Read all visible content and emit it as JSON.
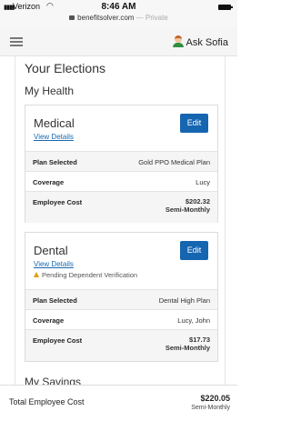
{
  "status_bar": {
    "carrier": "Verizon",
    "time": "8:46 AM",
    "url": "benefitsolver.com",
    "mode": "Private"
  },
  "header": {
    "ask_label": "Ask Sofia"
  },
  "page_title": "Your Elections",
  "sections": {
    "health": "My Health",
    "savings": "My Savings"
  },
  "medical": {
    "title": "Medical",
    "view_details": "View Details",
    "edit_label": "Edit",
    "rows": {
      "plan_label": "Plan Selected",
      "plan_value": "Gold PPO Medical Plan",
      "coverage_label": "Coverage",
      "coverage_value": "Lucy",
      "cost_label": "Employee Cost",
      "cost_value": "$202.32",
      "cost_period": "Semi-Monthly"
    }
  },
  "dental": {
    "title": "Dental",
    "view_details": "View Details",
    "edit_label": "Edit",
    "warning": "Pending Dependent Verification",
    "rows": {
      "plan_label": "Plan Selected",
      "plan_value": "Dental High Plan",
      "coverage_label": "Coverage",
      "coverage_value": "Lucy, John",
      "cost_label": "Employee Cost",
      "cost_value": "$17.73",
      "cost_period": "Semi-Monthly"
    }
  },
  "footer": {
    "label": "Total Employee Cost",
    "amount": "$220.05",
    "period": "Semi-Monthly"
  },
  "icons": {
    "signal": "cell-signal-icon",
    "wifi": "wifi-icon",
    "battery": "battery-icon",
    "lock": "lock-icon",
    "menu": "hamburger-menu-icon",
    "avatar": "sofia-avatar-icon",
    "warning": "warning-triangle-icon"
  },
  "colors": {
    "accent": "#1565b0",
    "link": "#1a6ab0",
    "warning": "#d9a200"
  }
}
